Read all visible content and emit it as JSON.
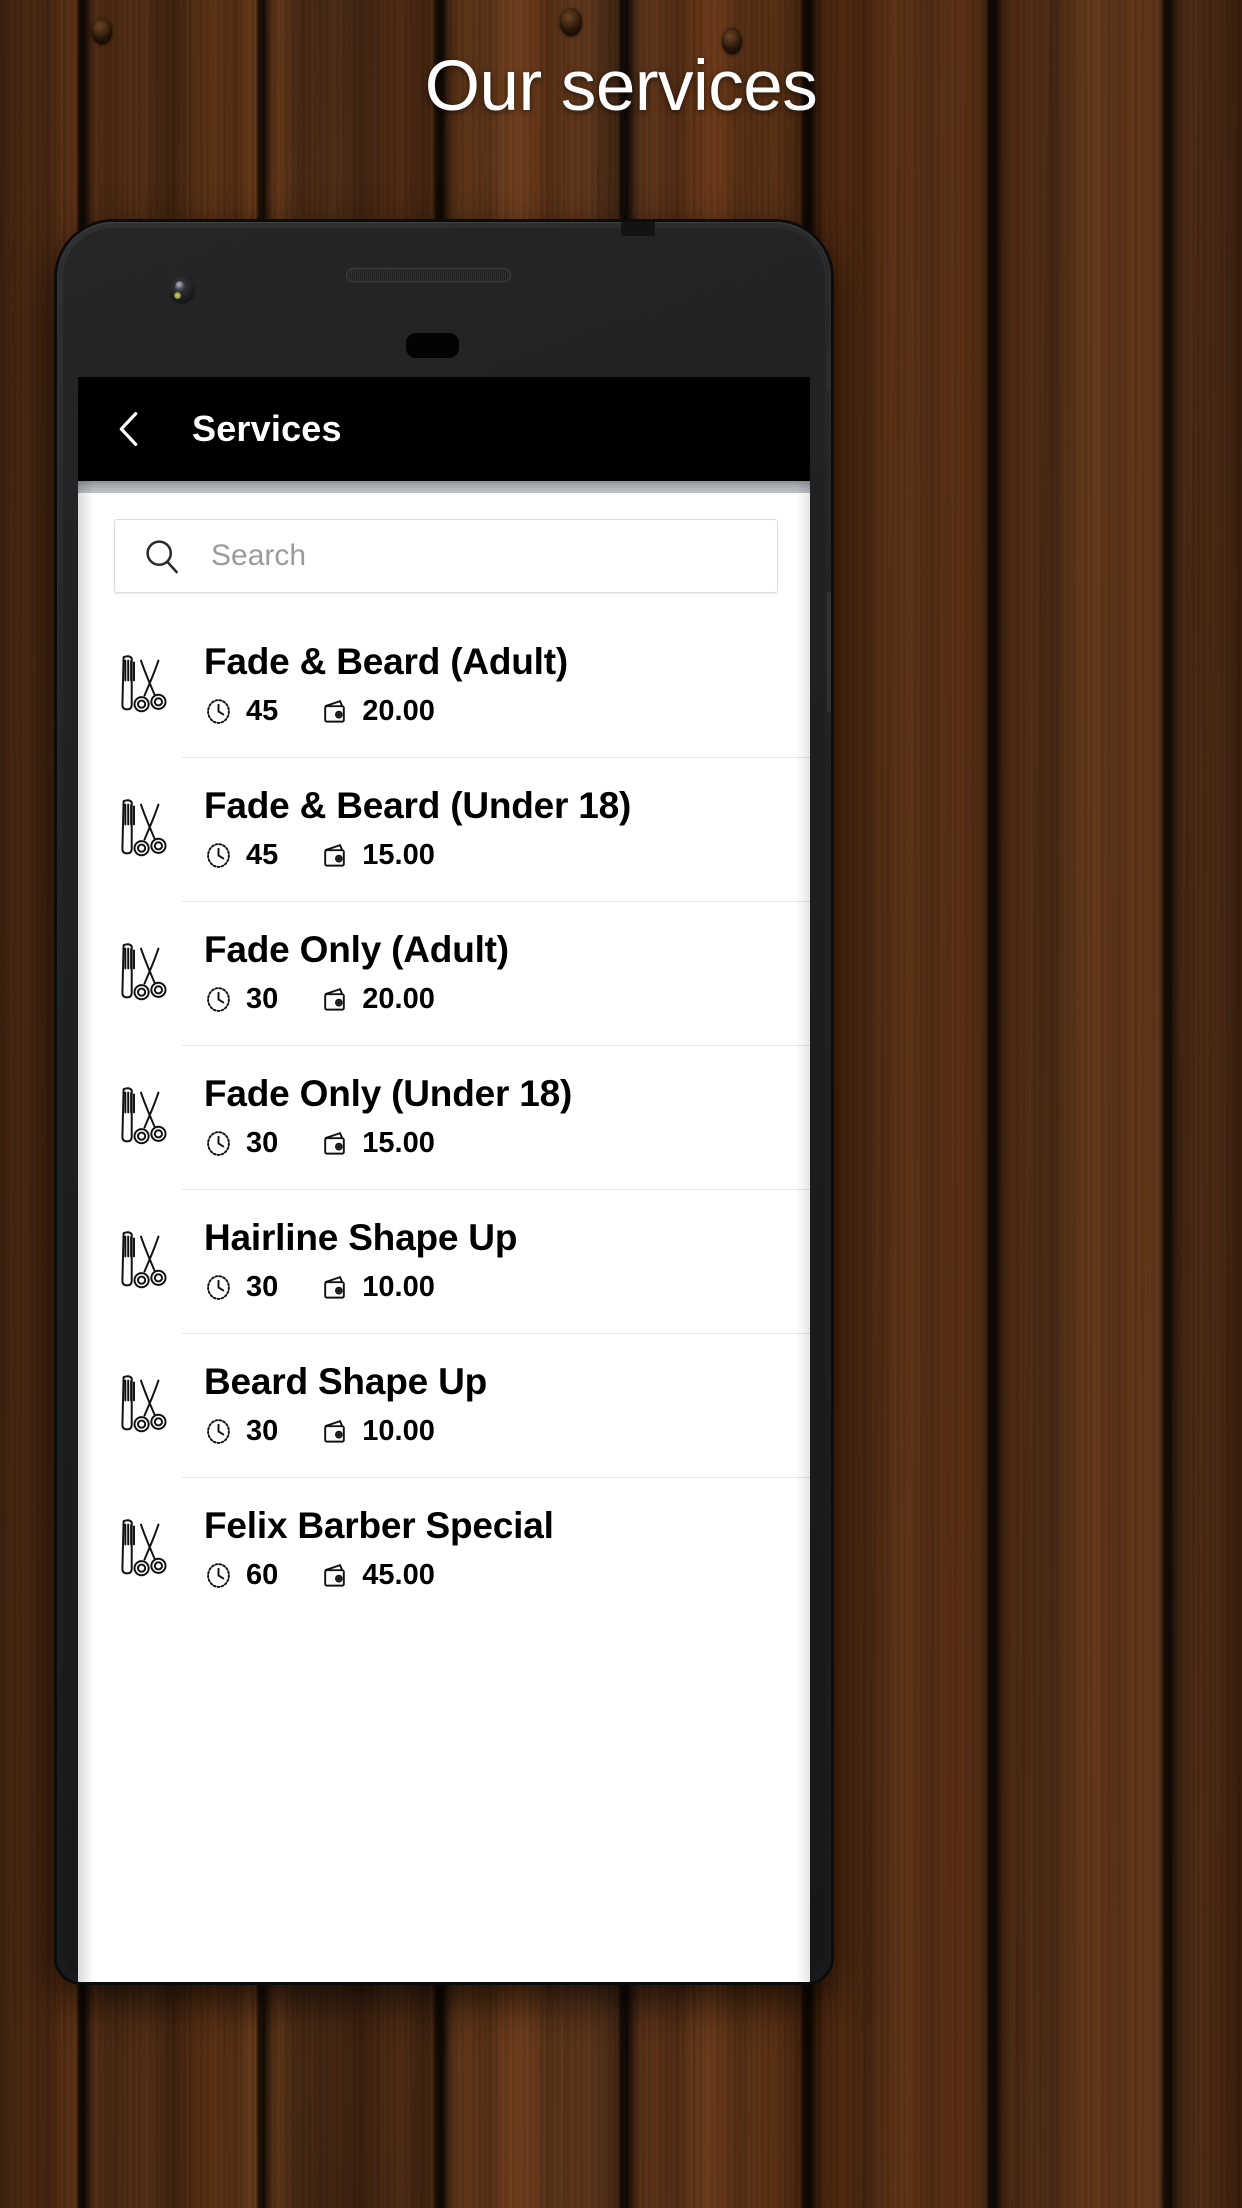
{
  "page": {
    "title": "Our services",
    "background_color": "#4a2c17",
    "title_color": "#ffffff"
  },
  "phone": {
    "camera_icon": "front-camera",
    "speaker_icon": "earpiece-speaker",
    "sensor_icon": "proximity-sensor"
  },
  "appbar": {
    "back_icon": "chevron-left-icon",
    "title": "Services",
    "background_color": "#000000",
    "text_color": "#ffffff"
  },
  "search": {
    "icon": "search-icon",
    "value": "",
    "placeholder": "Search"
  },
  "list": {
    "service_icon": "comb-scissors-icon",
    "duration_icon": "clock-icon",
    "price_icon": "wallet-icon",
    "items": [
      {
        "name": "Fade & Beard (Adult)",
        "duration": "45",
        "price": "20.00"
      },
      {
        "name": "Fade & Beard (Under 18)",
        "duration": "45",
        "price": "15.00"
      },
      {
        "name": "Fade Only (Adult)",
        "duration": "30",
        "price": "20.00"
      },
      {
        "name": "Fade Only (Under 18)",
        "duration": "30",
        "price": "15.00"
      },
      {
        "name": "Hairline Shape Up",
        "duration": "30",
        "price": "10.00"
      },
      {
        "name": "Beard Shape Up",
        "duration": "30",
        "price": "10.00"
      },
      {
        "name": "Felix Barber Special",
        "duration": "60",
        "price": "45.00"
      }
    ]
  }
}
